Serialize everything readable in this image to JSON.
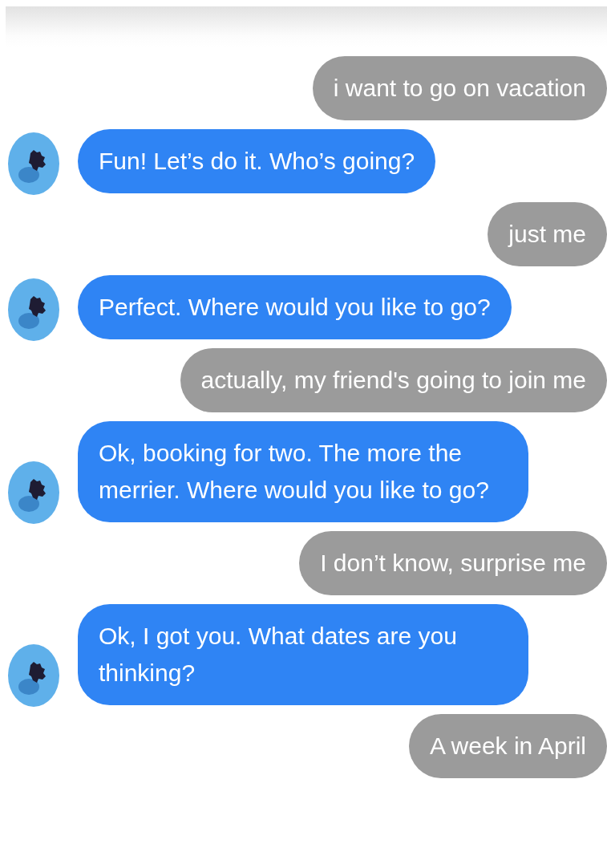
{
  "messages": [
    {
      "kind": "user",
      "text": "i want to go on vacation"
    },
    {
      "kind": "bot",
      "text": "Fun! Let’s do it. Who’s going?"
    },
    {
      "kind": "user",
      "text": "just me"
    },
    {
      "kind": "bot",
      "text": "Perfect. Where would you like to go?"
    },
    {
      "kind": "user",
      "text": "actually, my friend's going to join me"
    },
    {
      "kind": "bot",
      "text": "Ok, booking for two. The more the merrier. Where would you like to go?"
    },
    {
      "kind": "user",
      "text": "I don’t know, surprise me"
    },
    {
      "kind": "bot",
      "text": "Ok, I got you. What dates are you thinking?"
    },
    {
      "kind": "user",
      "text": "A week in April"
    }
  ]
}
